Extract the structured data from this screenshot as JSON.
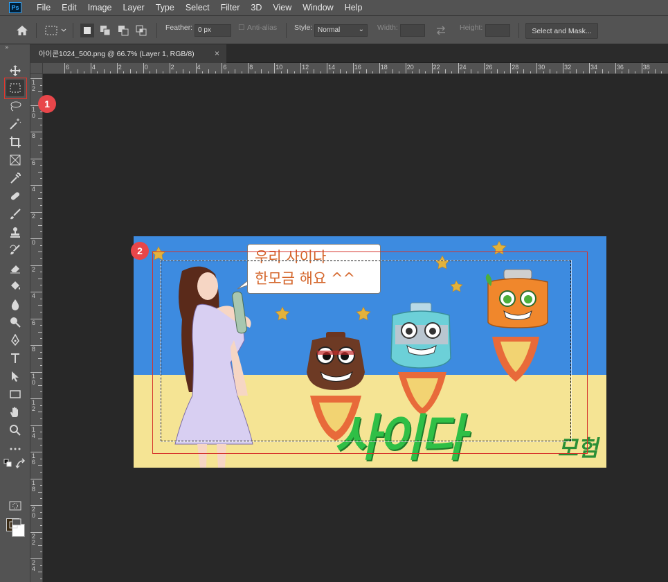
{
  "app": {
    "logo": "Ps"
  },
  "menu": [
    "File",
    "Edit",
    "Image",
    "Layer",
    "Type",
    "Select",
    "Filter",
    "3D",
    "View",
    "Window",
    "Help"
  ],
  "options": {
    "feather_label": "Feather:",
    "feather_value": "0 px",
    "antialias_label": "Anti-alias",
    "style_label": "Style:",
    "style_value": "Normal",
    "width_label": "Width:",
    "height_label": "Height:",
    "select_mask_label": "Select and Mask..."
  },
  "document": {
    "tab_title": "아이콘1024_500.png @ 66.7% (Layer 1, RGB/8)",
    "close_glyph": "×"
  },
  "ruler_h_labels": [
    "6",
    "4",
    "2",
    "0",
    "2",
    "4",
    "6",
    "8",
    "10",
    "12",
    "14",
    "16",
    "18",
    "20",
    "22",
    "24",
    "26",
    "28",
    "30",
    "32",
    "34",
    "36",
    "38"
  ],
  "ruler_v_labels": [
    "1 2",
    "1 0",
    "8",
    "6",
    "4",
    "2",
    "0",
    "2",
    "4",
    "6",
    "8",
    "1 0",
    "1 2",
    "1 4",
    "1 6",
    "1 8",
    "2 0",
    "2 2",
    "2 4"
  ],
  "artwork": {
    "bubble_line1": "우리 사이다",
    "bubble_line2": "한모금 해요 ^^",
    "title_big": "사이다",
    "title_small": "모험",
    "colors": {
      "sky": "#3d8be0",
      "sand": "#f5e494",
      "title": "#2fbf46"
    }
  },
  "annotations": {
    "badge1": "1",
    "badge2": "2",
    "color": "#e8464a"
  }
}
